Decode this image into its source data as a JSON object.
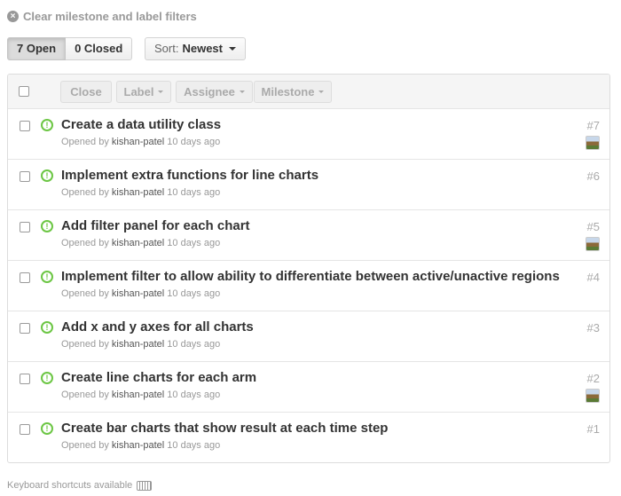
{
  "filters": {
    "clear_label": "Clear milestone and label filters"
  },
  "state_tabs": {
    "open_label": "7 Open",
    "closed_label": "0 Closed"
  },
  "sort": {
    "prefix": "Sort:",
    "value": "Newest"
  },
  "toolbar": {
    "close_label": "Close",
    "label_label": "Label",
    "assignee_label": "Assignee",
    "milestone_label": "Milestone"
  },
  "issues": [
    {
      "title": "Create a data utility class",
      "opened_by": "Opened by",
      "author": "kishan-patel",
      "age": "10 days ago",
      "number": "#7",
      "has_avatar": true
    },
    {
      "title": "Implement extra functions for line charts",
      "opened_by": "Opened by",
      "author": "kishan-patel",
      "age": "10 days ago",
      "number": "#6",
      "has_avatar": false
    },
    {
      "title": "Add filter panel for each chart",
      "opened_by": "Opened by",
      "author": "kishan-patel",
      "age": "10 days ago",
      "number": "#5",
      "has_avatar": true
    },
    {
      "title": "Implement filter to allow ability to differentiate between active/unactive regions",
      "opened_by": "Opened by",
      "author": "kishan-patel",
      "age": "10 days ago",
      "number": "#4",
      "has_avatar": false
    },
    {
      "title": "Add x and y axes for all charts",
      "opened_by": "Opened by",
      "author": "kishan-patel",
      "age": "10 days ago",
      "number": "#3",
      "has_avatar": false
    },
    {
      "title": "Create line charts for each arm",
      "opened_by": "Opened by",
      "author": "kishan-patel",
      "age": "10 days ago",
      "number": "#2",
      "has_avatar": true
    },
    {
      "title": "Create bar charts that show result at each time step",
      "opened_by": "Opened by",
      "author": "kishan-patel",
      "age": "10 days ago",
      "number": "#1",
      "has_avatar": false
    }
  ],
  "footer": {
    "keyboard_hint": "Keyboard shortcuts available"
  }
}
